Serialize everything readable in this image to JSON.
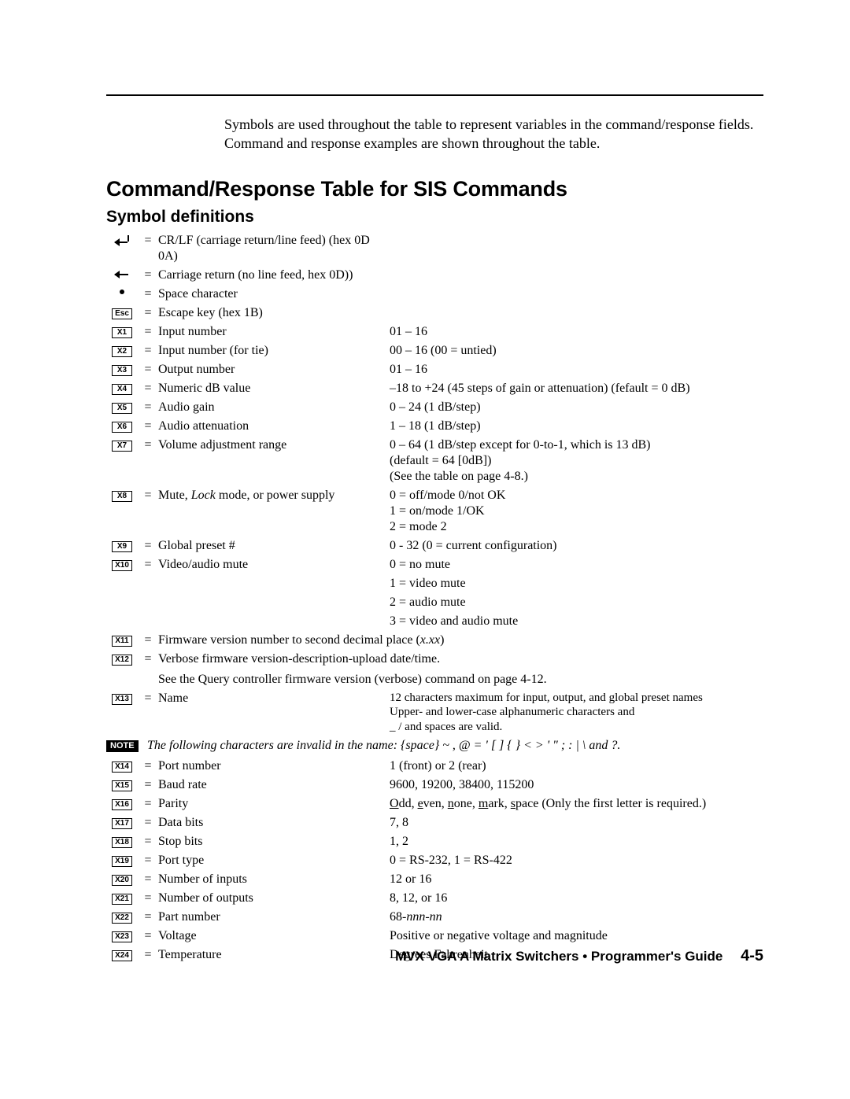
{
  "intro": "Symbols are used throughout the table to represent variables in the command/response fields.  Command and response examples are shown throughout the table.",
  "heading": "Command/Response Table for SIS Commands",
  "subheading": "Symbol definitions",
  "eq": "=",
  "defs": {
    "crlf": "CR/LF (carriage return/line feed) (hex 0D 0A)",
    "cr": "Carriage return (no line feed, hex 0D))",
    "space": "Space character",
    "esc_label": "Esc",
    "esc": "Escape key (hex 1B)",
    "x1_l": "X1",
    "x1_d": "Input number",
    "x1_r": "01 – 16",
    "x2_l": "X2",
    "x2_d": "Input number (for tie)",
    "x2_r": "00 – 16  (00 = untied)",
    "x3_l": "X3",
    "x3_d": "Output number",
    "x3_r": "01 – 16",
    "x4_l": "X4",
    "x4_d": "Numeric dB value",
    "x4_r": "–18 to +24 (45 steps of gain or attenuation) (fefault = 0 dB)",
    "x5_l": "X5",
    "x5_d": "Audio gain",
    "x5_r": "0 – 24 (1 dB/step)",
    "x6_l": "X6",
    "x6_d": "Audio attenuation",
    "x6_r": "1 – 18 (1 dB/step)",
    "x7_l": "X7",
    "x7_d": "Volume adjustment range",
    "x7_r1": "0 – 64 (1 dB/step except for 0-to-1, which is 13 dB)",
    "x7_r2": "(default = 64 [0dB])",
    "x7_r3": "(See the table on page 4-8.)",
    "x8_l": "X8",
    "x8_d_a": "Mute, ",
    "x8_d_b": "Lock",
    "x8_d_c": " mode, or power supply",
    "x8_r1": "0 = off/mode 0/not OK",
    "x8_r2": "1 = on/mode 1/OK",
    "x8_r3": "2 = mode 2",
    "x9_l": "X9",
    "x9_d": "Global preset #",
    "x9_r": "0 - 32 (0 = current configuration)",
    "x10_l": "X10",
    "x10_d": "Video/audio mute",
    "x10_r1": "0 = no mute",
    "x10_r2": "1 = video mute",
    "x10_r3": "2 = audio mute",
    "x10_r4": "3 = video and audio mute",
    "x11_l": "X11",
    "x11_d_a": "Firmware version number to second decimal place (",
    "x11_d_b": "x.xx",
    "x11_d_c": ")",
    "x12_l": "X12",
    "x12_d": "Verbose firmware version-description-upload date/time.",
    "x12_sub": "See the Query controller firmware version (verbose) command on page 4-12.",
    "x13_l": "X13",
    "x13_d": "Name",
    "x13_r1": "12 characters maximum for input, output, and global preset names",
    "x13_r2": "Upper- and lower-case alphanumeric characters and",
    "x13_r3": "_ / and spaces are valid.",
    "note_label": "NOTE",
    "note_text": "The following characters are invalid in the name: {space} ~ , @ = ' [ ] { } < > ' \" ; : | \\ and ?.",
    "x14_l": "X14",
    "x14_d": "Port number",
    "x14_r": "1 (front) or 2 (rear)",
    "x15_l": "X15",
    "x15_d": "Baud rate",
    "x15_r": "9600, 19200, 38400, 115200",
    "x16_l": "X16",
    "x16_d": "Parity",
    "x16_o": "O",
    "x16_dd": "dd, ",
    "x16_e": "e",
    "x16_ven": "ven, ",
    "x16_n": "n",
    "x16_one": "one, ",
    "x16_m": "m",
    "x16_ark": "ark, ",
    "x16_s": "s",
    "x16_pace": "pace (Only the first letter is required.)",
    "x17_l": "X17",
    "x17_d": "Data bits",
    "x17_r": "7, 8",
    "x18_l": "X18",
    "x18_d": "Stop bits",
    "x18_r": "1, 2",
    "x19_l": "X19",
    "x19_d": "Port type",
    "x19_r": "0 = RS-232, 1 = RS-422",
    "x20_l": "X20",
    "x20_d": "Number of inputs",
    "x20_r": "12 or 16",
    "x21_l": "X21",
    "x21_d": "Number of outputs",
    "x21_r": "8, 12, or 16",
    "x22_l": "X22",
    "x22_d": "Part number",
    "x22_r_a": "68-",
    "x22_r_b": "nnn-nn",
    "x23_l": "X23",
    "x23_d": "Voltage",
    "x23_r": "Positive or negative voltage and magnitude",
    "x24_l": "X24",
    "x24_d": "Temperature",
    "x24_r": "Degrees Fahrenheit"
  },
  "footer_title": "MVX VGA A Matrix Switchers • Programmer's Guide",
  "footer_page": "4-5"
}
